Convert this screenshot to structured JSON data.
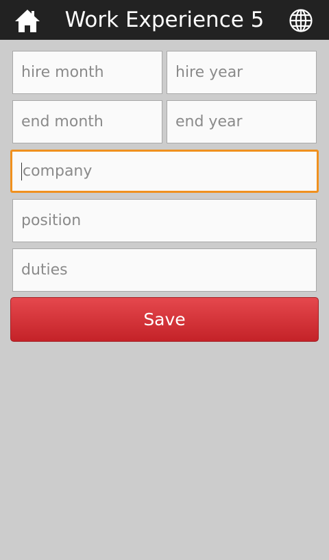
{
  "header": {
    "title": "Work Experience 5",
    "home_icon": "home-icon",
    "globe_icon": "globe-icon"
  },
  "form": {
    "hire_month": {
      "placeholder": "hire month",
      "value": ""
    },
    "hire_year": {
      "placeholder": "hire year",
      "value": ""
    },
    "end_month": {
      "placeholder": "end month",
      "value": ""
    },
    "end_year": {
      "placeholder": "end year",
      "value": ""
    },
    "company": {
      "placeholder": "company",
      "value": "",
      "focused": true
    },
    "position": {
      "placeholder": "position",
      "value": ""
    },
    "duties": {
      "placeholder": "duties",
      "value": ""
    }
  },
  "save_button": {
    "label": "Save"
  },
  "colors": {
    "header_bg": "#222222",
    "page_bg": "#cccccc",
    "focus_border": "#f0901e",
    "save_bg": "#d6333a"
  }
}
